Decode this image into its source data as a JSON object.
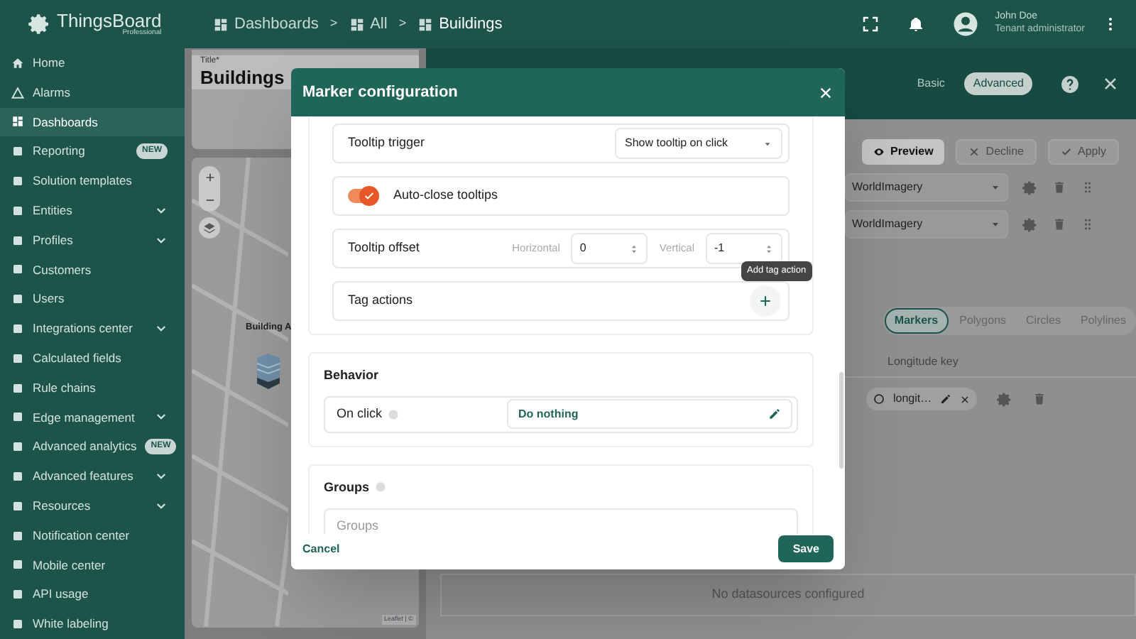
{
  "header": {
    "logo": "ThingsBoard",
    "logo_sub": "Professional",
    "breadcrumbs": [
      "Dashboards",
      "All",
      "Buildings"
    ],
    "separator": ">",
    "user_name": "John Doe",
    "user_role": "Tenant administrator"
  },
  "sidebar": {
    "items": [
      {
        "label": "Home",
        "selected": false,
        "expandable": false
      },
      {
        "label": "Alarms",
        "selected": false,
        "expandable": false
      },
      {
        "label": "Dashboards",
        "selected": true,
        "expandable": false
      },
      {
        "label": "Reporting",
        "selected": false,
        "expandable": false,
        "badge": "NEW"
      },
      {
        "label": "Solution templates",
        "selected": false,
        "expandable": false
      },
      {
        "label": "Entities",
        "selected": false,
        "expandable": true
      },
      {
        "label": "Profiles",
        "selected": false,
        "expandable": true
      },
      {
        "label": "Customers",
        "selected": false,
        "expandable": false
      },
      {
        "label": "Users",
        "selected": false,
        "expandable": false
      },
      {
        "label": "Integrations center",
        "selected": false,
        "expandable": true
      },
      {
        "label": "Calculated fields",
        "selected": false,
        "expandable": false
      },
      {
        "label": "Rule chains",
        "selected": false,
        "expandable": false
      },
      {
        "label": "Edge management",
        "selected": false,
        "expandable": true
      },
      {
        "label": "Advanced analytics",
        "selected": false,
        "expandable": false,
        "badge": "NEW"
      },
      {
        "label": "Advanced features",
        "selected": false,
        "expandable": true
      },
      {
        "label": "Resources",
        "selected": false,
        "expandable": true
      },
      {
        "label": "Notification center",
        "selected": false,
        "expandable": false
      },
      {
        "label": "Mobile center",
        "selected": false,
        "expandable": false
      },
      {
        "label": "API usage",
        "selected": false,
        "expandable": false
      },
      {
        "label": "White labeling",
        "selected": false,
        "expandable": false
      }
    ]
  },
  "dashboard": {
    "title_label": "Title*",
    "title": "Buildings",
    "map": {
      "marker_label": "Building A",
      "attribution": "Leaflet | ©"
    }
  },
  "widget_editor": {
    "modes": [
      {
        "label": "Basic",
        "selected": false
      },
      {
        "label": "Advanced",
        "selected": true
      }
    ],
    "actions": [
      {
        "kind": "preview",
        "label": "Preview",
        "disabled": false
      },
      {
        "kind": "decline",
        "label": "Decline",
        "disabled": true
      },
      {
        "kind": "apply",
        "label": "Apply",
        "disabled": true
      }
    ],
    "layers": [
      {
        "value": "WorldImagery"
      },
      {
        "value": "WorldImagery"
      }
    ],
    "overlay_tabs": [
      {
        "label": "Markers",
        "selected": true
      },
      {
        "label": "Polygons",
        "selected": false
      },
      {
        "label": "Circles",
        "selected": false
      },
      {
        "label": "Polylines",
        "selected": false
      }
    ],
    "table": {
      "columns": [
        "Longitude key"
      ],
      "rows": [
        {
          "key_chip": "longit…"
        }
      ]
    },
    "empty_message": "No datasources configured"
  },
  "modal": {
    "title": "Marker configuration",
    "rows": [
      {
        "kind": "select",
        "label": "Tooltip trigger",
        "value": "Show tooltip on click"
      },
      {
        "kind": "toggle",
        "label": "Auto-close tooltips",
        "on": true
      },
      {
        "kind": "offset",
        "label": "Tooltip offset",
        "fields": [
          {
            "label": "Horizontal",
            "value": "0"
          },
          {
            "label": "Vertical",
            "value": "-1"
          }
        ]
      },
      {
        "kind": "add",
        "label": "Tag actions",
        "tooltip": "Add tag action"
      }
    ],
    "behavior": {
      "title": "Behavior",
      "label": "On click",
      "value": "Do nothing"
    },
    "groups": {
      "title": "Groups",
      "placeholder": "Groups"
    },
    "cancel": "Cancel",
    "save": "Save"
  }
}
